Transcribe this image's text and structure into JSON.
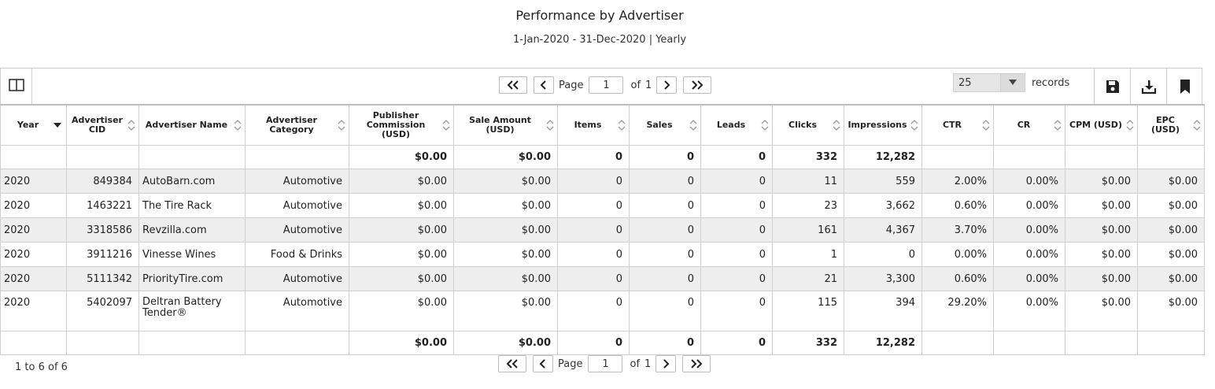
{
  "report": {
    "title": "Performance by Advertiser",
    "subtitle": "1-Jan-2020 - 31-Dec-2020 | Yearly"
  },
  "pager": {
    "page_label": "Page",
    "page_value": "1",
    "of_label": "of",
    "total_pages": "1"
  },
  "records": {
    "selected": "25",
    "label": "records"
  },
  "icons": {
    "columns": "columns-toggle-icon",
    "first": "first-page-icon",
    "prev": "prev-page-icon",
    "next": "next-page-icon",
    "last": "last-page-icon",
    "save": "save-icon",
    "download": "download-icon",
    "bookmark": "bookmark-icon",
    "sort": "sort-icon"
  },
  "colors": {
    "link": "#1f4e63",
    "row_alt": "#eeeeee",
    "border": "#cfcfcf"
  },
  "table": {
    "headers": {
      "year": "Year",
      "cid_1": "Advertiser",
      "cid_2": "CID",
      "name": "Advertiser Name",
      "cat_1": "Advertiser",
      "cat_2": "Category",
      "commission_1": "Publisher",
      "commission_2": "Commission (USD)",
      "sale_1": "Sale Amount",
      "sale_2": "(USD)",
      "items": "Items",
      "sales": "Sales",
      "leads": "Leads",
      "clicks": "Clicks",
      "impressions": "Impressions",
      "ctr": "CTR",
      "cr": "CR",
      "cpm": "CPM (USD)",
      "epc_1": "EPC",
      "epc_2": "(USD)"
    },
    "top_total": {
      "commission": "$0.00",
      "sale": "$0.00",
      "items": "0",
      "sales": "0",
      "leads": "0",
      "clicks": "332",
      "impressions": "12,282"
    },
    "rows": [
      {
        "year": "2020",
        "cid": "849384",
        "name": "AutoBarn.com",
        "category": "Automotive",
        "commission": "$0.00",
        "sale": "$0.00",
        "items": "0",
        "sales": "0",
        "leads": "0",
        "clicks": "11",
        "impressions": "559",
        "ctr": "2.00%",
        "cr": "0.00%",
        "cpm": "$0.00",
        "epc": "$0.00"
      },
      {
        "year": "2020",
        "cid": "1463221",
        "name": "The Tire Rack",
        "category": "Automotive",
        "commission": "$0.00",
        "sale": "$0.00",
        "items": "0",
        "sales": "0",
        "leads": "0",
        "clicks": "23",
        "impressions": "3,662",
        "ctr": "0.60%",
        "cr": "0.00%",
        "cpm": "$0.00",
        "epc": "$0.00"
      },
      {
        "year": "2020",
        "cid": "3318586",
        "name": "Revzilla.com",
        "category": "Automotive",
        "commission": "$0.00",
        "sale": "$0.00",
        "items": "0",
        "sales": "0",
        "leads": "0",
        "clicks": "161",
        "impressions": "4,367",
        "ctr": "3.70%",
        "cr": "0.00%",
        "cpm": "$0.00",
        "epc": "$0.00"
      },
      {
        "year": "2020",
        "cid": "3911216",
        "name": "Vinesse Wines",
        "category": "Food & Drinks",
        "commission": "$0.00",
        "sale": "$0.00",
        "items": "0",
        "sales": "0",
        "leads": "0",
        "clicks": "1",
        "impressions": "0",
        "ctr": "0.00%",
        "cr": "0.00%",
        "cpm": "$0.00",
        "epc": "$0.00"
      },
      {
        "year": "2020",
        "cid": "5111342",
        "name": "PriorityTire.com",
        "category": "Automotive",
        "commission": "$0.00",
        "sale": "$0.00",
        "items": "0",
        "sales": "0",
        "leads": "0",
        "clicks": "21",
        "impressions": "3,300",
        "ctr": "0.60%",
        "cr": "0.00%",
        "cpm": "$0.00",
        "epc": "$0.00"
      },
      {
        "year": "2020",
        "cid": "5402097",
        "name": "Deltran Battery Tender®",
        "category": "Automotive",
        "commission": "$0.00",
        "sale": "$0.00",
        "items": "0",
        "sales": "0",
        "leads": "0",
        "clicks": "115",
        "impressions": "394",
        "ctr": "29.20%",
        "cr": "0.00%",
        "cpm": "$0.00",
        "epc": "$0.00"
      }
    ],
    "bottom_total": {
      "commission": "$0.00",
      "sale": "$0.00",
      "items": "0",
      "sales": "0",
      "leads": "0",
      "clicks": "332",
      "impressions": "12,282"
    }
  },
  "footer": {
    "count": "1 to 6 of 6"
  }
}
